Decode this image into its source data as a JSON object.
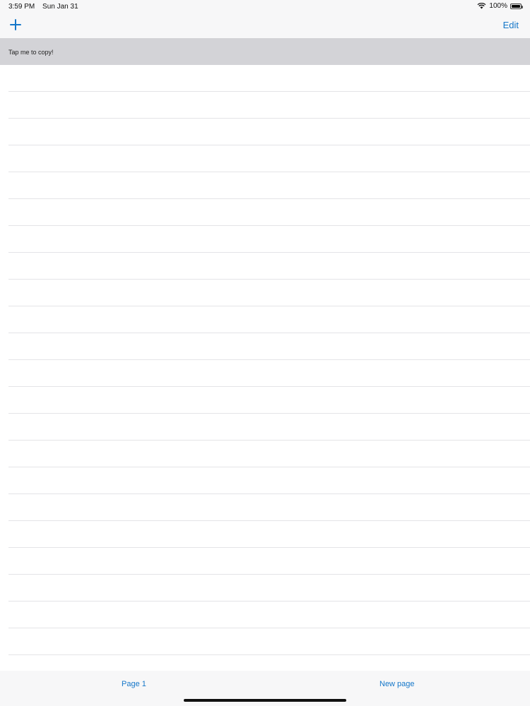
{
  "status_bar": {
    "time": "3:59 PM",
    "date": "Sun Jan 31",
    "battery": "100%",
    "battery_level": 1.0,
    "wifi_icon": "wifi-icon",
    "battery_icon": "battery-icon"
  },
  "nav": {
    "add_icon": "plus-icon",
    "edit_label": "Edit"
  },
  "banner": {
    "text": "Tap me to copy!"
  },
  "list": {
    "rows": [
      "",
      "",
      "",
      "",
      "",
      "",
      "",
      "",
      "",
      "",
      "",
      "",
      "",
      "",
      "",
      "",
      "",
      "",
      "",
      "",
      "",
      ""
    ]
  },
  "toolbar": {
    "page_label": "Page 1",
    "new_page_label": "New page"
  },
  "colors": {
    "accent": "#1577c9",
    "banner_bg": "#d3d3d7",
    "separator": "#e4e4e7"
  }
}
